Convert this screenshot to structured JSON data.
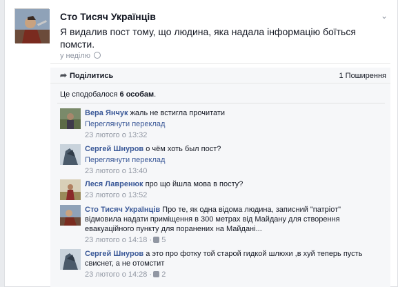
{
  "post": {
    "page_name": "Сто Тисяч Українців",
    "text": "Я видалив пост тому, що людина, яка надала інформацію боїться помсти.",
    "time": "у неділю",
    "menu_icon": "chevron-down-icon",
    "privacy_icon": "globe-icon"
  },
  "actions": {
    "share_label": "Поділитись",
    "share_count": "1 Поширення"
  },
  "likes": {
    "prefix": "Це сподобалося",
    "count": "6 особам",
    "suffix": "."
  },
  "comments": [
    {
      "author": "Вера Янчук",
      "text": "жаль не встигла прочитати",
      "translate": "Переглянути переклад",
      "time": "23 лютого о 13:32",
      "likes": ""
    },
    {
      "author": "Сергей Шнуров",
      "text": "о чём хоть был пост?",
      "translate": "Переглянути переклад",
      "time": "23 лютого о 13:40",
      "likes": ""
    },
    {
      "author": "Леся Лавренюк",
      "text": "про що йшла мова в посту?",
      "translate": "",
      "time": "23 лютого о 13:52",
      "likes": ""
    },
    {
      "author": "Сто Тисяч Українців",
      "text": "Про те, як одна відома людина, записний \"патріот\" відмовила надати приміщення в 300 метрах від Майдану для створення евакуаційного пункту для поранених на Майдані...",
      "translate": "",
      "time": "23 лютого о 14:18 ·",
      "likes": "5"
    },
    {
      "author": "Сергей Шнуров",
      "text": "а это про фотку той старой гидкой шлюхи ,в хуй теперь пусть свиснет, а не отомстит",
      "translate": "",
      "time": "23 лютого о 14:28 ·",
      "likes": "2"
    }
  ]
}
